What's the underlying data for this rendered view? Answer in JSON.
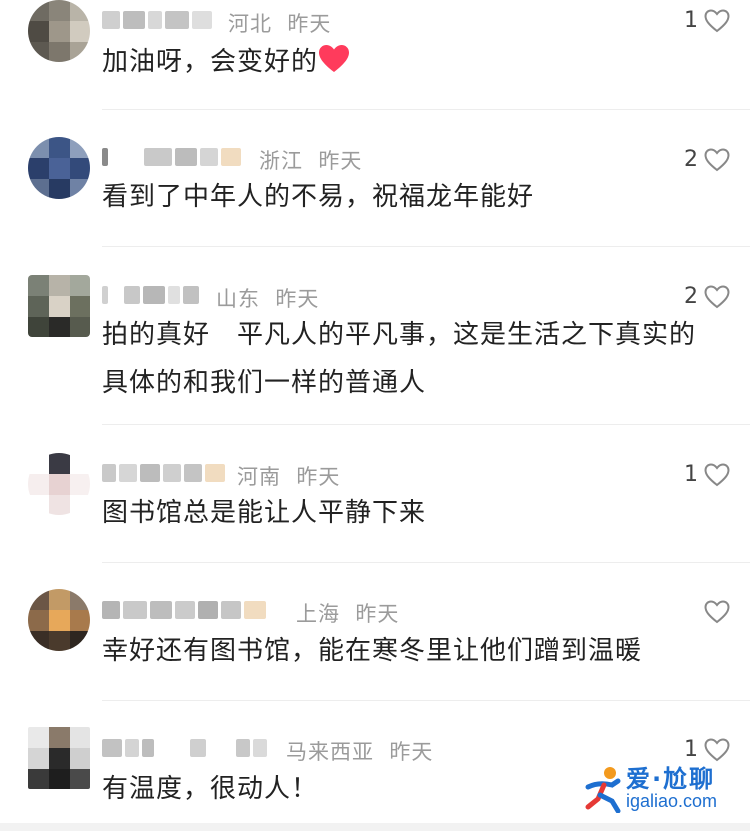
{
  "comments": [
    {
      "region": "河北",
      "time": "昨天",
      "text": "加油呀，会变好的",
      "likes": "1",
      "has_heart_emoji": true
    },
    {
      "region": "浙江",
      "time": "昨天",
      "text": "看到了中年人的不易，祝福龙年能好",
      "likes": "2"
    },
    {
      "region": "山东",
      "time": "昨天",
      "text": "拍的真好　平凡人的平凡事，这是生活之下真实的具体的和我们一样的普通人",
      "likes": "2"
    },
    {
      "region": "河南",
      "time": "昨天",
      "text": "图书馆总是能让人平静下来",
      "likes": "1"
    },
    {
      "region": "上海",
      "time": "昨天",
      "text": "幸好还有图书馆，能在寒冬里让他们蹭到温暖",
      "likes": ""
    },
    {
      "region": "马来西亚",
      "time": "昨天",
      "text": "有温度，很动人！",
      "likes": "1"
    }
  ],
  "watermark": {
    "line1": "爱·尬聊",
    "line2": "igaliao.com"
  },
  "colors": {
    "text": "#222222",
    "meta": "#9b9b9b",
    "divider": "#ededed",
    "heart": "#888888",
    "emoji_heart": "#ff3b5c",
    "watermark": "#1e6fd0"
  }
}
